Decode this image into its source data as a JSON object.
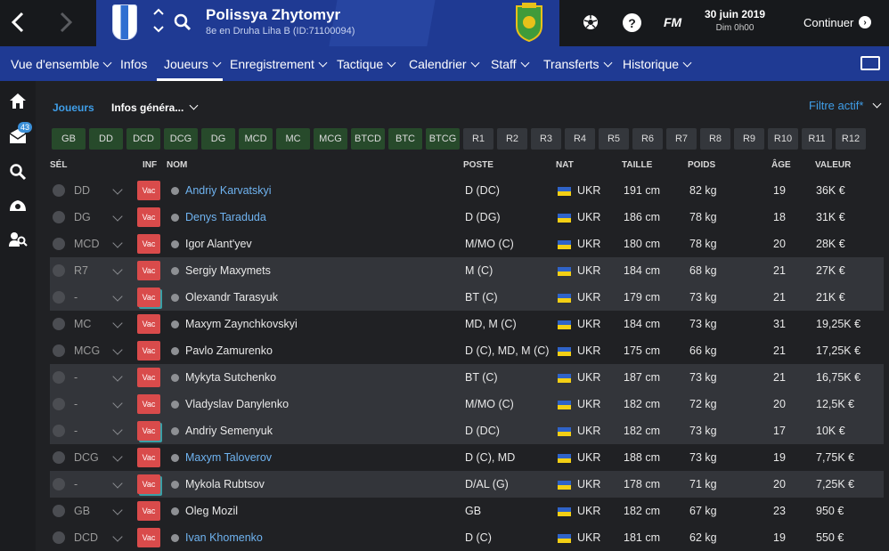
{
  "header": {
    "club_name": "Polissya Zhytomyr",
    "club_sub": "8e en Druha Liha B (ID:71100094)",
    "fm_label": "FM",
    "date": "30 juin 2019",
    "time": "Dim 0h00",
    "continue_label": "Continuer",
    "help_label": "?"
  },
  "menu": {
    "items": [
      {
        "label": "Vue d'ensemble",
        "chevron": true
      },
      {
        "label": "Infos",
        "chevron": false
      },
      {
        "label": "Joueurs",
        "chevron": true
      },
      {
        "label": "Enregistrement",
        "chevron": true
      },
      {
        "label": "Tactique",
        "chevron": true
      },
      {
        "label": "Calendrier",
        "chevron": true
      },
      {
        "label": "Staff",
        "chevron": true
      },
      {
        "label": "Transferts",
        "chevron": true
      },
      {
        "label": "Historique",
        "chevron": true
      }
    ]
  },
  "sidebar": {
    "inbox_badge": "43"
  },
  "subnav": {
    "joueurs": "Joueurs",
    "view": "Infos généra...",
    "filter": "Filtre actif*"
  },
  "chips": {
    "positions": [
      "GB",
      "DD",
      "DCD",
      "DCG",
      "DG",
      "MCD",
      "MC",
      "MCG",
      "BTCD",
      "BTC",
      "BTCG"
    ],
    "roles": [
      "R1",
      "R2",
      "R3",
      "R4",
      "R5",
      "R6",
      "R7",
      "R8",
      "R9",
      "R10",
      "R11",
      "R12"
    ]
  },
  "table": {
    "headers": {
      "sel": "SÉL",
      "inf": "INF",
      "nom": "NOM",
      "poste": "POSTE",
      "nat": "NAT",
      "taille": "TAILLE",
      "poids": "POIDS",
      "age": "ÂGE",
      "valeur": "VALEUR"
    },
    "rows": [
      {
        "role": "DD",
        "name": "Andriy Karvatskyi",
        "link": true,
        "poste": "D (DC)",
        "nat": "UKR",
        "taille": "191 cm",
        "poids": "82 kg",
        "age": "19",
        "valeur": "36K €",
        "hl": false,
        "stack": false
      },
      {
        "role": "DG",
        "name": "Denys Taraduda",
        "link": true,
        "poste": "D (DG)",
        "nat": "UKR",
        "taille": "186 cm",
        "poids": "78 kg",
        "age": "18",
        "valeur": "31K €",
        "hl": false,
        "stack": false
      },
      {
        "role": "MCD",
        "name": "Igor Alant'yev",
        "link": false,
        "poste": "M/MO (C)",
        "nat": "UKR",
        "taille": "180 cm",
        "poids": "78 kg",
        "age": "20",
        "valeur": "28K €",
        "hl": false,
        "stack": false
      },
      {
        "role": "R7",
        "name": "Sergiy Maxymets",
        "link": false,
        "poste": "M (C)",
        "nat": "UKR",
        "taille": "184 cm",
        "poids": "68 kg",
        "age": "21",
        "valeur": "27K €",
        "hl": true,
        "stack": false
      },
      {
        "role": "-",
        "name": "Olexandr Tarasyuk",
        "link": false,
        "poste": "BT (C)",
        "nat": "UKR",
        "taille": "179 cm",
        "poids": "73 kg",
        "age": "21",
        "valeur": "21K €",
        "hl": true,
        "stack": true
      },
      {
        "role": "MC",
        "name": "Maxym Zaynchkovskyi",
        "link": false,
        "poste": "MD, M (C)",
        "nat": "UKR",
        "taille": "184 cm",
        "poids": "73 kg",
        "age": "31",
        "valeur": "19,25K €",
        "hl": false,
        "stack": false
      },
      {
        "role": "MCG",
        "name": "Pavlo Zamurenko",
        "link": false,
        "poste": "D (C), MD, M (C)",
        "nat": "UKR",
        "taille": "175 cm",
        "poids": "66 kg",
        "age": "21",
        "valeur": "17,25K €",
        "hl": false,
        "stack": false
      },
      {
        "role": "-",
        "name": "Mykyta Sutchenko",
        "link": false,
        "poste": "BT (C)",
        "nat": "UKR",
        "taille": "187 cm",
        "poids": "73 kg",
        "age": "21",
        "valeur": "16,75K €",
        "hl": true,
        "stack": false
      },
      {
        "role": "-",
        "name": "Vladyslav Danylenko",
        "link": false,
        "poste": "M/MO (C)",
        "nat": "UKR",
        "taille": "182 cm",
        "poids": "72 kg",
        "age": "20",
        "valeur": "12,5K €",
        "hl": true,
        "stack": false
      },
      {
        "role": "-",
        "name": "Andriy Semenyuk",
        "link": false,
        "poste": "D (DC)",
        "nat": "UKR",
        "taille": "182 cm",
        "poids": "73 kg",
        "age": "17",
        "valeur": "10K €",
        "hl": true,
        "stack": true
      },
      {
        "role": "DCG",
        "name": "Maxym Taloverov",
        "link": true,
        "poste": "D (C), MD",
        "nat": "UKR",
        "taille": "188 cm",
        "poids": "73 kg",
        "age": "19",
        "valeur": "7,75K €",
        "hl": false,
        "stack": false
      },
      {
        "role": "-",
        "name": "Mykola Rubtsov",
        "link": false,
        "poste": "D/AL (G)",
        "nat": "UKR",
        "taille": "178 cm",
        "poids": "71 kg",
        "age": "20",
        "valeur": "7,25K €",
        "hl": true,
        "stack": true
      },
      {
        "role": "GB",
        "name": "Oleg Mozil",
        "link": false,
        "poste": "GB",
        "nat": "UKR",
        "taille": "182 cm",
        "poids": "67 kg",
        "age": "23",
        "valeur": "950 €",
        "hl": false,
        "stack": false
      },
      {
        "role": "DCD",
        "name": "Ivan Khomenko",
        "link": true,
        "poste": "D (C)",
        "nat": "UKR",
        "taille": "181 cm",
        "poids": "62 kg",
        "age": "19",
        "valeur": "550 €",
        "hl": false,
        "stack": false
      }
    ],
    "vac_label": "Vac"
  }
}
